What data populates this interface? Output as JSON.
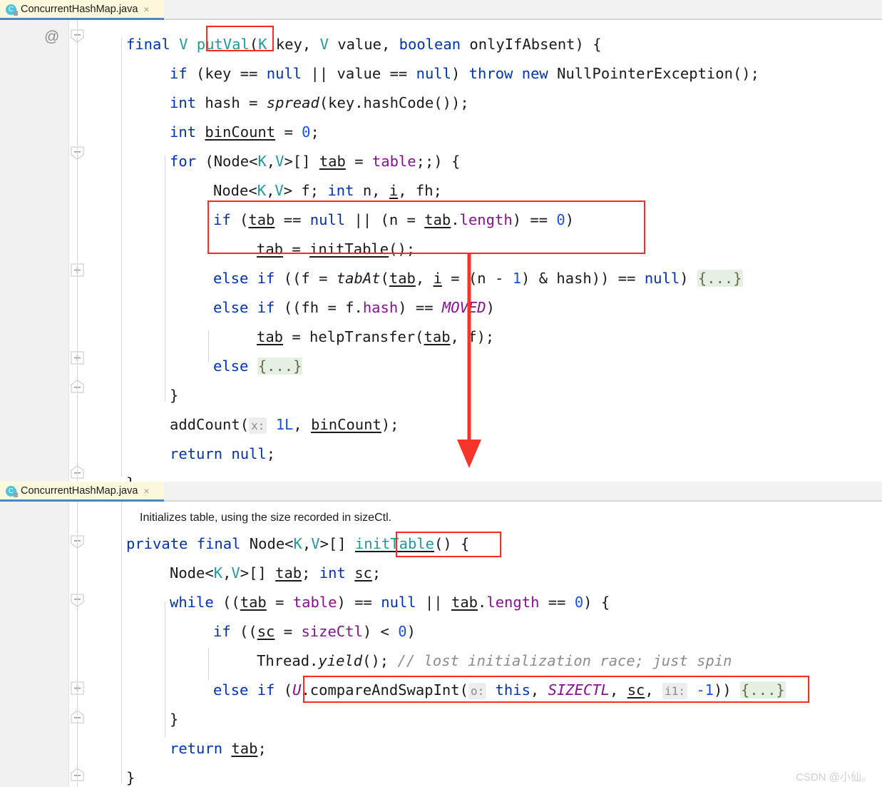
{
  "window": {
    "app": "IntelliJ IDEA Editor",
    "watermark": "CSDN @小仙。"
  },
  "colors": {
    "keyword": "#0033b3",
    "number": "#1750eb",
    "generic": "#20999d",
    "field": "#871094",
    "comment": "#8c8c8c",
    "fold_placeholder_bg": "#e3f0e3",
    "annotation_red": "#ff2a1f",
    "tab_active_bg": "#fdf8dc",
    "tab_underline": "#4a86c8"
  },
  "panes": [
    {
      "tab": {
        "label": "ConcurrentHashMap.java",
        "icon": "java-class-icon",
        "close": "×"
      },
      "gutter_annotation": "@",
      "lines": [
        {
          "indent": 0,
          "text": "final V putVal(K key, V value, boolean onlyIfAbsent) {"
        },
        {
          "indent": 1,
          "text": "if (key == null || value == null) throw new NullPointerException();"
        },
        {
          "indent": 1,
          "text": "int hash = spread(key.hashCode());"
        },
        {
          "indent": 1,
          "text": "int binCount = 0;"
        },
        {
          "indent": 1,
          "text": "for (Node<K,V>[] tab = table;;) {"
        },
        {
          "indent": 2,
          "text": "Node<K,V> f; int n, i, fh;"
        },
        {
          "indent": 2,
          "text": "if (tab == null || (n = tab.length) == 0)"
        },
        {
          "indent": 3,
          "text": "tab = initTable();"
        },
        {
          "indent": 2,
          "text": "else if ((f = tabAt(tab, i = (n - 1) & hash)) == null) {...}"
        },
        {
          "indent": 2,
          "text": "else if ((fh = f.hash) == MOVED)"
        },
        {
          "indent": 3,
          "text": "tab = helpTransfer(tab, f);"
        },
        {
          "indent": 2,
          "text": "else {...}"
        },
        {
          "indent": 1,
          "text": "}"
        },
        {
          "indent": 1,
          "text": "addCount( x: 1L, binCount);"
        },
        {
          "indent": 1,
          "text": "return null;"
        },
        {
          "indent": 0,
          "text": "}"
        }
      ],
      "inlay_hints": [
        {
          "line": 13,
          "label": "x:"
        }
      ]
    },
    {
      "tab": {
        "label": "ConcurrentHashMap.java",
        "icon": "java-class-icon",
        "close": "×"
      },
      "doc_comment": "Initializes table, using the size recorded in sizeCtl.",
      "lines": [
        {
          "indent": 0,
          "text": "private final Node<K,V>[] initTable() {"
        },
        {
          "indent": 1,
          "text": "Node<K,V>[] tab; int sc;"
        },
        {
          "indent": 1,
          "text": "while ((tab = table) == null || tab.length == 0) {"
        },
        {
          "indent": 2,
          "text": "if ((sc = sizeCtl) < 0)"
        },
        {
          "indent": 3,
          "text": "Thread.yield(); // lost initialization race; just spin"
        },
        {
          "indent": 2,
          "text": "else if (U.compareAndSwapInt( o: this, SIZECTL, sc, i1: -1)) {...}"
        },
        {
          "indent": 1,
          "text": "}"
        },
        {
          "indent": 1,
          "text": "return tab;"
        },
        {
          "indent": 0,
          "text": "}"
        }
      ],
      "inlay_hints": [
        {
          "line": 5,
          "label": "o:"
        },
        {
          "line": 5,
          "label": "i1:"
        }
      ]
    }
  ],
  "annotations": {
    "highlight_putval": "putVal",
    "highlight_inittable_call": "if (tab == null || (n = tab.length) == 0) / tab = initTable();",
    "highlight_inittable_decl": "initTable",
    "highlight_cas": "U.compareAndSwapInt( o: this, SIZECTL, sc, i1: -1))",
    "arrow": "down-arrow-from-putval-to-inittable"
  }
}
